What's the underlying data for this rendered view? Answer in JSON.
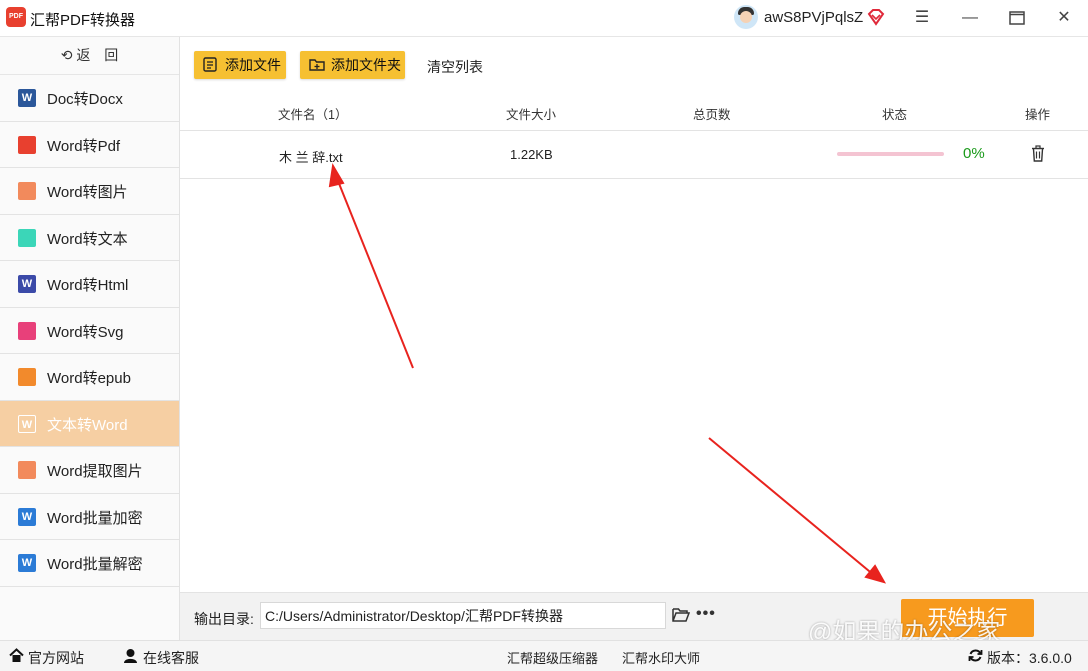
{
  "app": {
    "title": "汇帮PDF转换器",
    "logo_text": "PDF"
  },
  "user": {
    "name": "awS8PVjPqlsZ"
  },
  "sidebar": {
    "back_label": "返　回",
    "items": [
      {
        "label": "Doc转Docx",
        "icon": "word-doc-icon",
        "color": "#2b579a"
      },
      {
        "label": "Word转Pdf",
        "icon": "pdf-icon",
        "color": "#e8402f"
      },
      {
        "label": "Word转图片",
        "icon": "image-icon",
        "color": "#f28a5c"
      },
      {
        "label": "Word转文本",
        "icon": "text-file-icon",
        "color": "#3bd6b8"
      },
      {
        "label": "Word转Html",
        "icon": "html-icon",
        "color": "#3b4aa8"
      },
      {
        "label": "Word转Svg",
        "icon": "svg-image-icon",
        "color": "#e8407a"
      },
      {
        "label": "Word转epub",
        "icon": "epub-icon",
        "color": "#f28a2c"
      },
      {
        "label": "文本转Word",
        "icon": "word-icon",
        "color": "#ffffff",
        "active": true
      },
      {
        "label": "Word提取图片",
        "icon": "extract-image-icon",
        "color": "#f28a5c"
      },
      {
        "label": "Word批量加密",
        "icon": "word-encrypt-icon",
        "color": "#2b7bd6"
      },
      {
        "label": "Word批量解密",
        "icon": "word-decrypt-icon",
        "color": "#2b7bd6"
      }
    ]
  },
  "toolbar": {
    "add_file": "添加文件",
    "add_folder": "添加文件夹",
    "clear_list": "清空列表"
  },
  "table": {
    "headers": {
      "filename": "文件名（1）",
      "size": "文件大小",
      "pages": "总页数",
      "status": "状态",
      "action": "操作"
    },
    "rows": [
      {
        "filename": "木 兰 辞.txt",
        "size": "1.22KB",
        "pages": "",
        "progress": 0,
        "progress_text": "0%"
      }
    ]
  },
  "output": {
    "label": "输出目录:",
    "path": "C:/Users/Administrator/Desktop/汇帮PDF转换器",
    "start_button": "开始执行"
  },
  "statusbar": {
    "website": "官方网站",
    "support": "在线客服",
    "compressor": "汇帮超级压缩器",
    "watermark_master": "汇帮水印大师",
    "version": "版本：3.6.0.0"
  },
  "watermark": "@如果的办公之家",
  "colors": {
    "accent_yellow": "#f6c032",
    "start_orange": "#f79a1e",
    "active_nav": "#f6cfa3",
    "progress_green": "#1a9a1a",
    "arrow_red": "#e8231e"
  }
}
